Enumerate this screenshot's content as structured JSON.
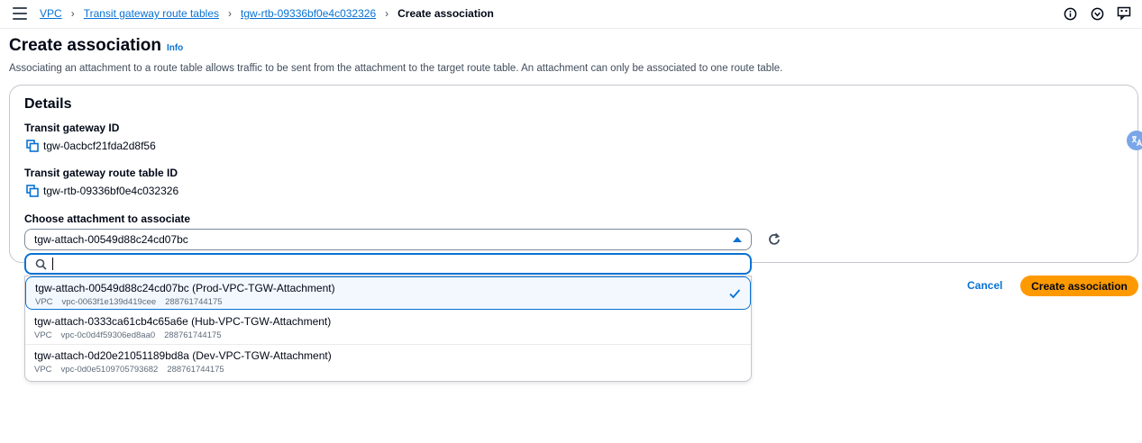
{
  "breadcrumb": {
    "items": [
      "VPC",
      "Transit gateway route tables",
      "tgw-rtb-09336bf0e4c032326"
    ],
    "current": "Create association"
  },
  "header": {
    "title": "Create association",
    "info_label": "Info",
    "description": "Associating an attachment to a route table allows traffic to be sent from the attachment to the target route table. An attachment can only be associated to one route table."
  },
  "details": {
    "heading": "Details",
    "tgw_id_label": "Transit gateway ID",
    "tgw_id_value": "tgw-0acbcf21fda2d8f56",
    "rtb_id_label": "Transit gateway route table ID",
    "rtb_id_value": "tgw-rtb-09336bf0e4c032326",
    "attachment_label": "Choose attachment to associate",
    "attachment_selected": "tgw-attach-00549d88c24cd07bc"
  },
  "dropdown": {
    "search_value": "",
    "options": [
      {
        "title": "tgw-attach-00549d88c24cd07bc (Prod-VPC-TGW-Attachment)",
        "type": "VPC",
        "vpc": "vpc-0063f1e139d419cee",
        "account": "288761744175",
        "selected": true
      },
      {
        "title": "tgw-attach-0333ca61cb4c65a6e (Hub-VPC-TGW-Attachment)",
        "type": "VPC",
        "vpc": "vpc-0c0d4f59306ed8aa0",
        "account": "288761744175",
        "selected": false
      },
      {
        "title": "tgw-attach-0d20e21051189bd8a (Dev-VPC-TGW-Attachment)",
        "type": "VPC",
        "vpc": "vpc-0d0e5109705793682",
        "account": "288761744175",
        "selected": false
      }
    ]
  },
  "actions": {
    "cancel_label": "Cancel",
    "create_label": "Create association"
  },
  "colors": {
    "link": "#0972d3",
    "primary_button": "#ff9900",
    "text": "#000716"
  }
}
